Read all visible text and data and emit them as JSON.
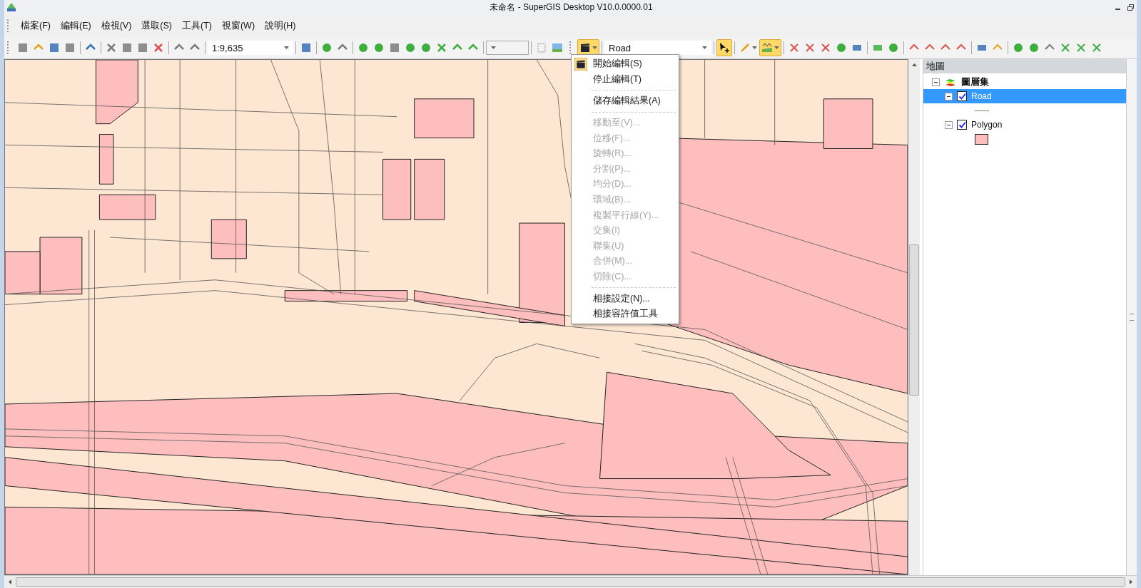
{
  "window": {
    "title": "未命名 - SuperGIS Desktop V10.0.0000.01"
  },
  "menu_bar": [
    "檔案(F)",
    "編輯(E)",
    "檢視(V)",
    "選取(S)",
    "工具(T)",
    "視窗(W)",
    "說明(H)"
  ],
  "toolbar": {
    "scale": "1:9,635",
    "layer": "Road",
    "editor_menu_open": true,
    "edit_tool_active": true,
    "sketch_tool_active": true
  },
  "editor_menu": [
    {
      "kind": "item",
      "label": "開始編輯(S)",
      "disabled": false
    },
    {
      "kind": "item",
      "label": "停止編輯(T)",
      "disabled": false
    },
    {
      "kind": "separator"
    },
    {
      "kind": "item",
      "label": "儲存編輯結果(A)",
      "disabled": false
    },
    {
      "kind": "separator"
    },
    {
      "kind": "item",
      "label": "移動至(V)...",
      "disabled": true
    },
    {
      "kind": "item",
      "label": "位移(F)...",
      "disabled": true
    },
    {
      "kind": "item",
      "label": "旋轉(R)...",
      "disabled": true
    },
    {
      "kind": "item",
      "label": "分割(P)...",
      "disabled": true
    },
    {
      "kind": "item",
      "label": "均分(D)...",
      "disabled": true
    },
    {
      "kind": "item",
      "label": "環域(B)...",
      "disabled": true
    },
    {
      "kind": "item",
      "label": "複製平行線(Y)...",
      "disabled": true
    },
    {
      "kind": "item",
      "label": "交集(I)",
      "disabled": true
    },
    {
      "kind": "item",
      "label": "聯集(U)",
      "disabled": true
    },
    {
      "kind": "item",
      "label": "合併(M)...",
      "disabled": true
    },
    {
      "kind": "item",
      "label": "切除(C)...",
      "disabled": true
    },
    {
      "kind": "separator"
    },
    {
      "kind": "item",
      "label": "相接設定(N)...",
      "disabled": false
    },
    {
      "kind": "item",
      "label": "相接容許值工具",
      "disabled": false
    }
  ],
  "layer_panel": {
    "title": "地圖",
    "root": {
      "label": "圖層集",
      "expanded": true,
      "children": [
        {
          "label": "Road",
          "checked": true,
          "selected": true,
          "expanded": true,
          "kind": "line",
          "color": "#8a7f74"
        },
        {
          "label": "Polygon",
          "checked": true,
          "selected": false,
          "expanded": true,
          "kind": "fill",
          "color": "#ffbebe"
        }
      ]
    }
  }
}
